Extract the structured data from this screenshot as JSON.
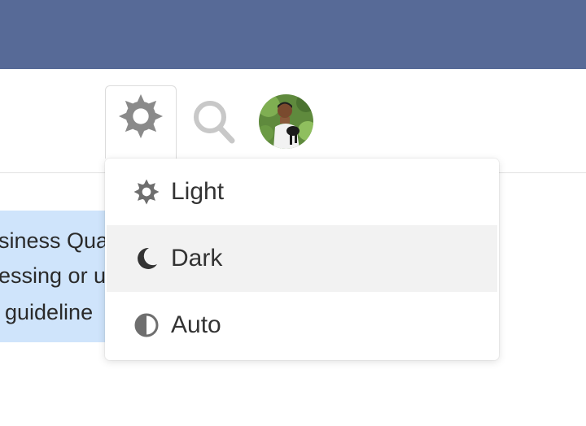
{
  "header": {
    "bar_color": "#576a97",
    "theme_button_icon": "gear-sun-icon",
    "search_icon": "search-icon",
    "avatar_alt": "user avatar"
  },
  "alert": {
    "background": "#cfe4fb",
    "lines": [
      "siness Qua",
      "essing or u",
      "guideline"
    ]
  },
  "theme_menu": {
    "items": [
      {
        "label": "Light",
        "icon": "sun-icon"
      },
      {
        "label": "Dark",
        "icon": "moon-icon",
        "highlighted": true
      },
      {
        "label": "Auto",
        "icon": "half-circle-icon"
      }
    ]
  }
}
